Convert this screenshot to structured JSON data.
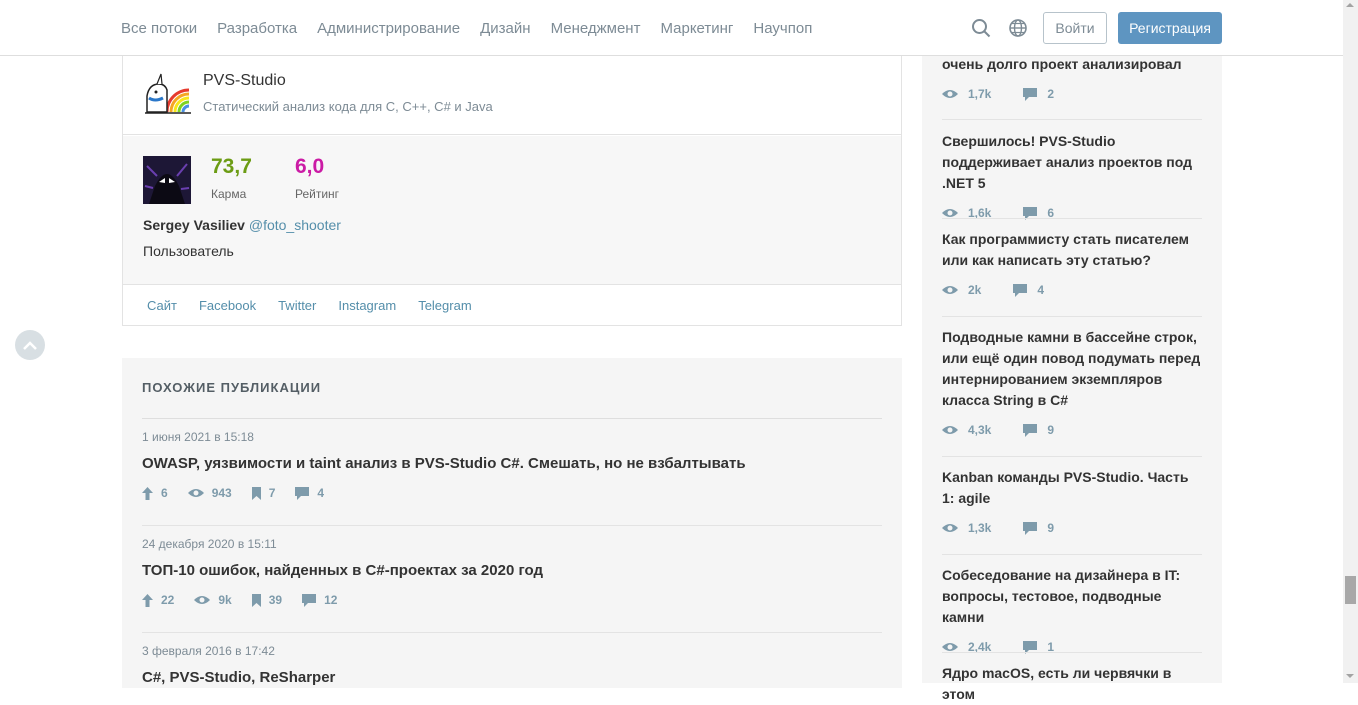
{
  "header": {
    "nav": [
      "Все потоки",
      "Разработка",
      "Администрирование",
      "Дизайн",
      "Менеджмент",
      "Маркетинг",
      "Научпоп"
    ],
    "search_icon": "search-icon",
    "language_icon": "globe-icon",
    "login_label": "Войти",
    "register_label": "Регистрация"
  },
  "company": {
    "name": "PVS-Studio",
    "description": "Статический анализ кода для C, C++, C# и Java"
  },
  "author": {
    "karma_value": "73,7",
    "karma_label": "Карма",
    "rating_value": "6,0",
    "rating_label": "Рейтинг",
    "name": "Sergey Vasiliev",
    "nickname": "@foto_shooter",
    "role": "Пользователь",
    "links": [
      "Сайт",
      "Facebook",
      "Twitter",
      "Instagram",
      "Telegram"
    ]
  },
  "similar": {
    "title": "ПОХОЖИЕ ПУБЛИКАЦИИ",
    "items": [
      {
        "date": "1 июня 2021 в 15:18",
        "title": "OWASP, уязвимости и taint анализ в PVS-Studio C#. Смешать, но не взбалтывать",
        "votes": "6",
        "views": "943",
        "bookmarks": "7",
        "comments": "4"
      },
      {
        "date": "24 декабря 2020 в 15:11",
        "title": "ТОП-10 ошибок, найденных в C#-проектах за 2020 год",
        "votes": "22",
        "views": "9k",
        "bookmarks": "39",
        "comments": "12"
      },
      {
        "date": "3 февраля 2016 в 17:42",
        "title": "C#, PVS-Studio, ReSharper"
      }
    ]
  },
  "sidebar": {
    "items": [
      {
        "title": "очень долго проект анализировал",
        "views": "1,7k",
        "comments": "2"
      },
      {
        "title": "Свершилось! PVS-Studio поддерживает анализ проектов под .NET 5",
        "views": "1,6k",
        "comments": "6"
      },
      {
        "title": "Как программисту стать писателем или как написать эту статью?",
        "views": "2k",
        "comments": "4"
      },
      {
        "title": "Подводные камни в бассейне строк, или ещё один повод подумать перед интернированием экземпляров класса String в C#",
        "views": "4,3k",
        "comments": "9"
      },
      {
        "title": "Kanban команды PVS-Studio. Часть 1: agile",
        "views": "1,3k",
        "comments": "9"
      },
      {
        "title": "Собеседование на дизайнера в IT: вопросы, тестовое, подводные камни",
        "views": "2,4k",
        "comments": "1"
      },
      {
        "title": "Ядро macOS, есть ли червячки в этом"
      }
    ]
  }
}
